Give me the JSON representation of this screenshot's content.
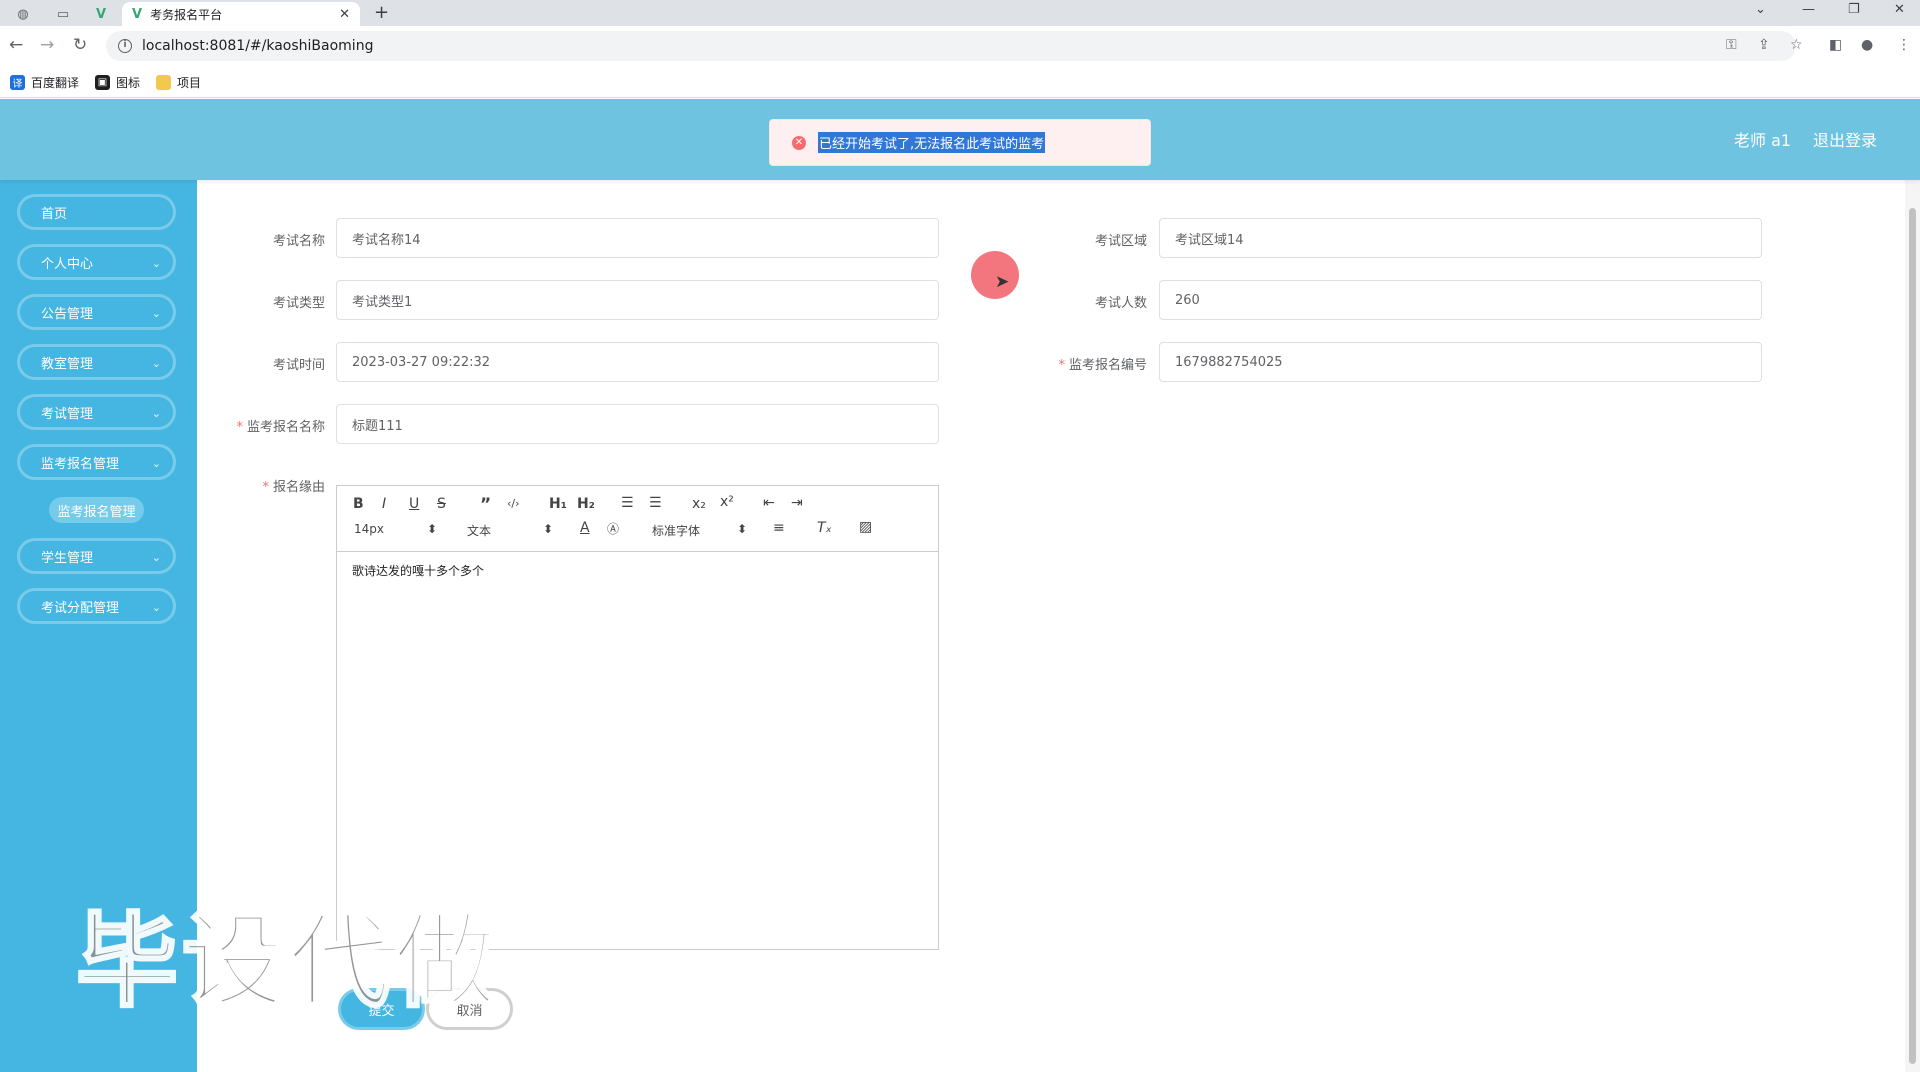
{
  "browser": {
    "tab_title": "考务报名平台",
    "tab_close": "✕",
    "new_tab": "+",
    "url": "localhost:8081/#/kaoshiBaoming",
    "bookmarks": [
      {
        "label": "百度翻译",
        "icon": "translate-icon",
        "color": "#1e6fd9"
      },
      {
        "label": "图标",
        "icon": "image-icon",
        "color": "#1f1f1f"
      },
      {
        "label": "项目",
        "icon": "folder-icon",
        "color": "#f2c94c"
      }
    ]
  },
  "header": {
    "user_label": "老师 a1",
    "logout_label": "退出登录",
    "color": "#6ec3e0"
  },
  "toast": {
    "message": "已经开始考试了,无法报名此考试的监考",
    "icon": "error-icon",
    "icon_glyph": "✕"
  },
  "sidebar": {
    "color": "#45b6e2",
    "items": [
      {
        "label": "首页",
        "chevron": ""
      },
      {
        "label": "个人中心",
        "chevron": "⌄"
      },
      {
        "label": "公告管理",
        "chevron": "⌄"
      },
      {
        "label": "教室管理",
        "chevron": "⌄"
      },
      {
        "label": "考试管理",
        "chevron": "⌄"
      },
      {
        "label": "监考报名管理",
        "chevron": "⌄"
      },
      {
        "label": "学生管理",
        "chevron": "⌄"
      },
      {
        "label": "考试分配管理",
        "chevron": "⌄"
      }
    ],
    "submenu_label": "监考报名管理"
  },
  "form": {
    "exam_name": {
      "label": "考试名称",
      "value": "考试名称14"
    },
    "exam_area": {
      "label": "考试区域",
      "value": "考试区域14"
    },
    "exam_type": {
      "label": "考试类型",
      "value": "考试类型1"
    },
    "exam_count": {
      "label": "考试人数",
      "value": "260"
    },
    "exam_time": {
      "label": "考试时间",
      "value": "2023-03-27 09:22:32"
    },
    "reg_number": {
      "label": "监考报名编号",
      "value": "1679882754025",
      "required": "*"
    },
    "reg_name": {
      "label": "监考报名名称",
      "value": "标题111",
      "required": "*"
    },
    "reason": {
      "label": "报名缘由",
      "required": "*",
      "content": "歌诗达发的嘎十多个多个"
    }
  },
  "editor": {
    "font_size": "14px",
    "header_select": "文本",
    "font_family": "标准字体",
    "select_arrow": "⬍"
  },
  "buttons": {
    "submit": "提交",
    "cancel": "取消"
  },
  "watermark": "毕设代做"
}
